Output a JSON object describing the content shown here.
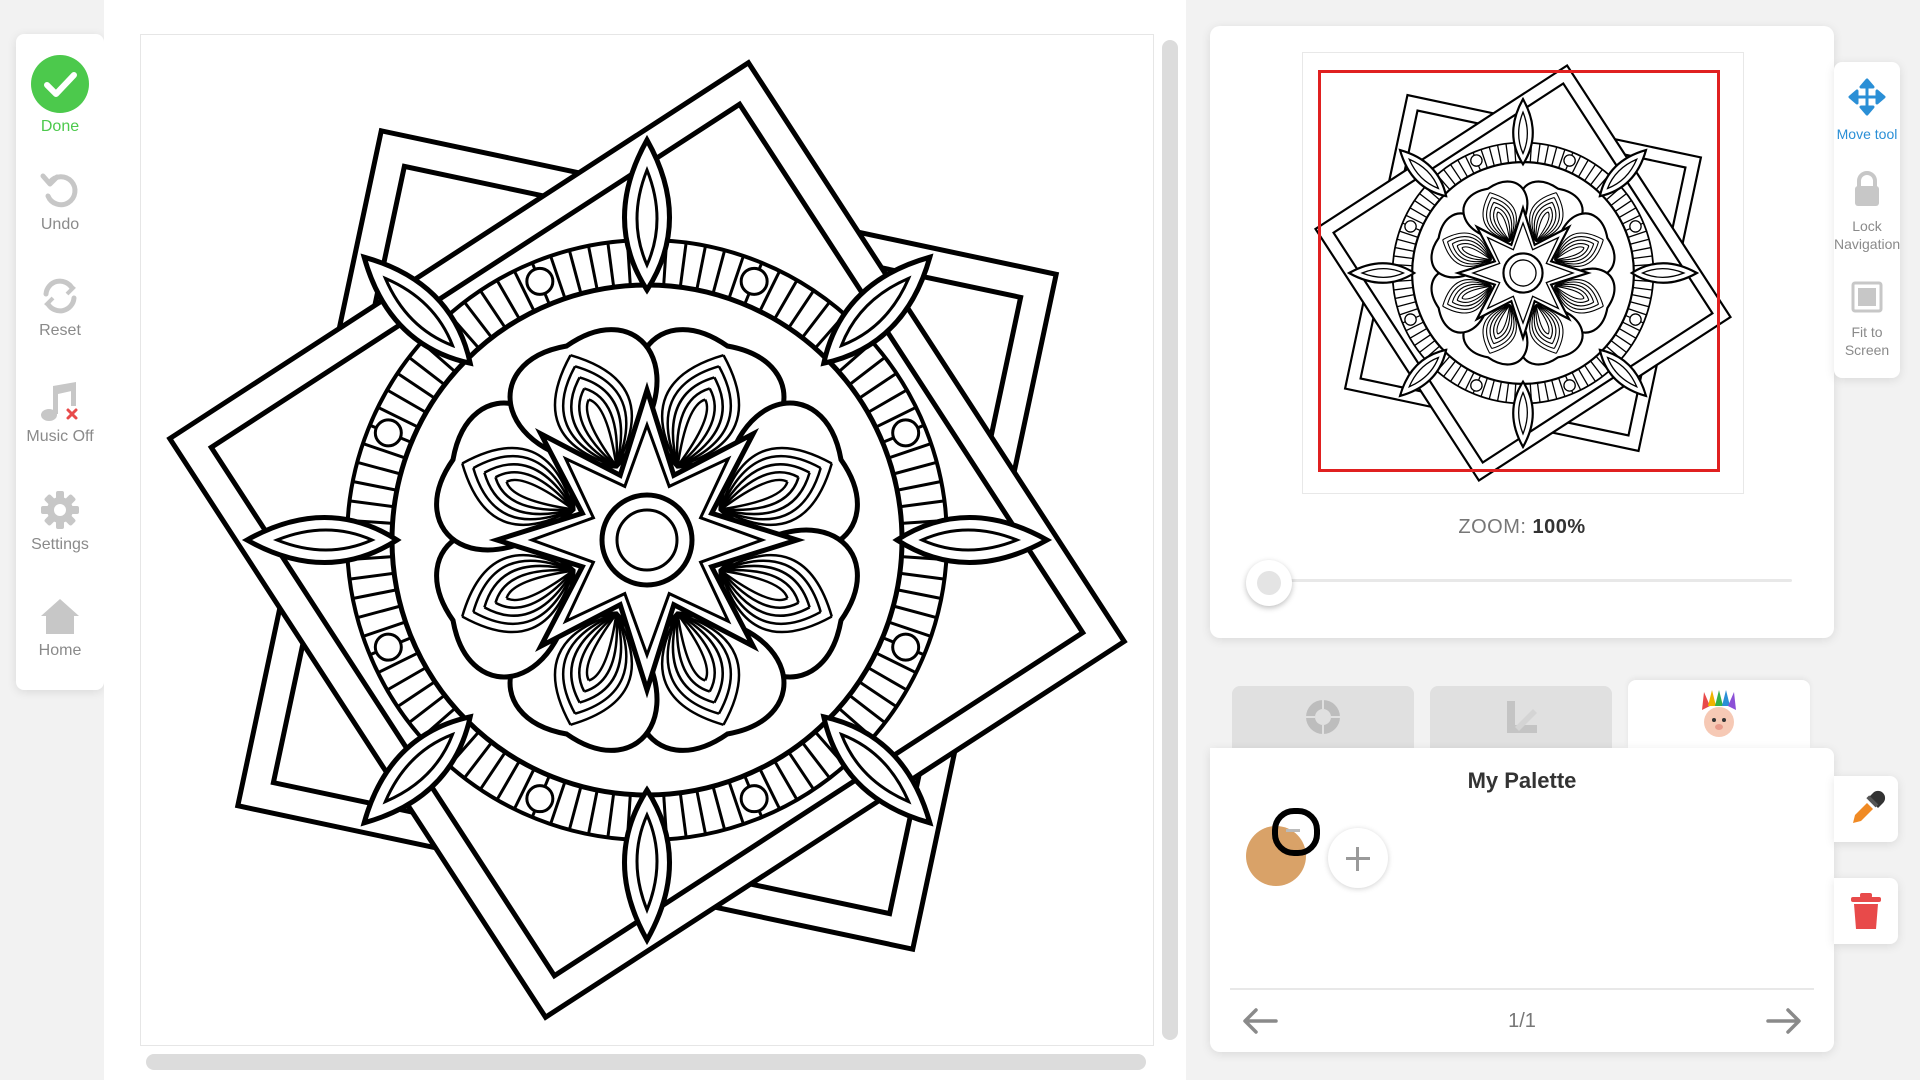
{
  "sidebar": {
    "items": [
      {
        "label": "Done",
        "icon": "check-circle-icon",
        "color": "#4cc94c"
      },
      {
        "label": "Undo",
        "icon": "undo-icon"
      },
      {
        "label": "Reset",
        "icon": "reset-icon"
      },
      {
        "label": "Music Off",
        "icon": "music-off-icon"
      },
      {
        "label": "Settings",
        "icon": "gear-icon"
      },
      {
        "label": "Home",
        "icon": "home-icon"
      }
    ]
  },
  "navigator": {
    "zoom_prefix": "ZOOM: ",
    "zoom_value": "100%",
    "zoom_fraction": 0.0
  },
  "tools": [
    {
      "label": "Move tool",
      "icon": "move-icon",
      "active": true
    },
    {
      "label": "Lock Navigation",
      "icon": "lock-icon"
    },
    {
      "label": "Fit to Screen",
      "icon": "fit-to-screen-icon"
    }
  ],
  "tabs": [
    {
      "icon": "color-wheel-icon"
    },
    {
      "icon": "shades-icon"
    },
    {
      "icon": "my-palette-avatar-icon",
      "active": true
    }
  ],
  "palette": {
    "title": "My Palette",
    "swatches": [
      "#d9a268"
    ],
    "page": "1/1"
  },
  "colors": {
    "accent": "#2a8fd6",
    "done_green": "#4cc94c",
    "viewport_red": "#e02020",
    "trash_red": "#e84a4a"
  }
}
